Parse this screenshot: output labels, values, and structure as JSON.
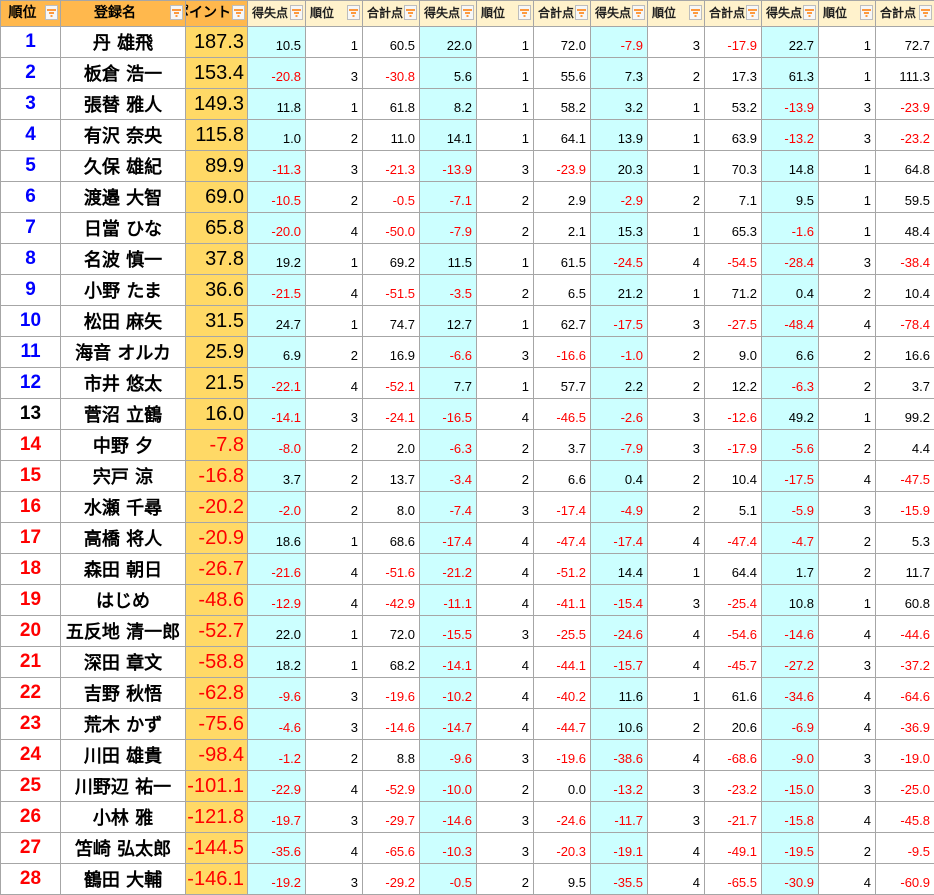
{
  "headers": [
    "順位",
    "登録名",
    "ポイント",
    "得失点",
    "順位",
    "合計点",
    "得失点",
    "順位",
    "合計点",
    "得失点",
    "順位",
    "合計点",
    "得失点",
    "順位",
    "合計点"
  ],
  "rows": [
    {
      "rank": "1",
      "name": "丹 雄飛",
      "pts": "187.3",
      "cells": [
        "10.5",
        "1",
        "60.5",
        "22.0",
        "1",
        "72.0",
        "-7.9",
        "3",
        "-17.9",
        "22.7",
        "1",
        "72.7"
      ]
    },
    {
      "rank": "2",
      "name": "板倉 浩一",
      "pts": "153.4",
      "cells": [
        "-20.8",
        "3",
        "-30.8",
        "5.6",
        "1",
        "55.6",
        "7.3",
        "2",
        "17.3",
        "61.3",
        "1",
        "111.3"
      ]
    },
    {
      "rank": "3",
      "name": "張替 雅人",
      "pts": "149.3",
      "cells": [
        "11.8",
        "1",
        "61.8",
        "8.2",
        "1",
        "58.2",
        "3.2",
        "1",
        "53.2",
        "-13.9",
        "3",
        "-23.9"
      ]
    },
    {
      "rank": "4",
      "name": "有沢 奈央",
      "pts": "115.8",
      "cells": [
        "1.0",
        "2",
        "11.0",
        "14.1",
        "1",
        "64.1",
        "13.9",
        "1",
        "63.9",
        "-13.2",
        "3",
        "-23.2"
      ]
    },
    {
      "rank": "5",
      "name": "久保 雄紀",
      "pts": "89.9",
      "cells": [
        "-11.3",
        "3",
        "-21.3",
        "-13.9",
        "3",
        "-23.9",
        "20.3",
        "1",
        "70.3",
        "14.8",
        "1",
        "64.8"
      ]
    },
    {
      "rank": "6",
      "name": "渡邉 大智",
      "pts": "69.0",
      "cells": [
        "-10.5",
        "2",
        "-0.5",
        "-7.1",
        "2",
        "2.9",
        "-2.9",
        "2",
        "7.1",
        "9.5",
        "1",
        "59.5"
      ]
    },
    {
      "rank": "7",
      "name": "日當 ひな",
      "pts": "65.8",
      "cells": [
        "-20.0",
        "4",
        "-50.0",
        "-7.9",
        "2",
        "2.1",
        "15.3",
        "1",
        "65.3",
        "-1.6",
        "1",
        "48.4"
      ]
    },
    {
      "rank": "8",
      "name": "名波 慎一",
      "pts": "37.8",
      "cells": [
        "19.2",
        "1",
        "69.2",
        "11.5",
        "1",
        "61.5",
        "-24.5",
        "4",
        "-54.5",
        "-28.4",
        "3",
        "-38.4"
      ]
    },
    {
      "rank": "9",
      "name": "小野 たま",
      "pts": "36.6",
      "cells": [
        "-21.5",
        "4",
        "-51.5",
        "-3.5",
        "2",
        "6.5",
        "21.2",
        "1",
        "71.2",
        "0.4",
        "2",
        "10.4"
      ]
    },
    {
      "rank": "10",
      "name": "松田 麻矢",
      "pts": "31.5",
      "cells": [
        "24.7",
        "1",
        "74.7",
        "12.7",
        "1",
        "62.7",
        "-17.5",
        "3",
        "-27.5",
        "-48.4",
        "4",
        "-78.4"
      ]
    },
    {
      "rank": "11",
      "name": "海音 オルカ",
      "pts": "25.9",
      "cells": [
        "6.9",
        "2",
        "16.9",
        "-6.6",
        "3",
        "-16.6",
        "-1.0",
        "2",
        "9.0",
        "6.6",
        "2",
        "16.6"
      ]
    },
    {
      "rank": "12",
      "name": "市井 悠太",
      "pts": "21.5",
      "cells": [
        "-22.1",
        "4",
        "-52.1",
        "7.7",
        "1",
        "57.7",
        "2.2",
        "2",
        "12.2",
        "-6.3",
        "2",
        "3.7"
      ]
    },
    {
      "rank": "13",
      "name": "菅沼 立鶴",
      "pts": "16.0",
      "cells": [
        "-14.1",
        "3",
        "-24.1",
        "-16.5",
        "4",
        "-46.5",
        "-2.6",
        "3",
        "-12.6",
        "49.2",
        "1",
        "99.2"
      ]
    },
    {
      "rank": "14",
      "name": "中野 夕",
      "pts": "-7.8",
      "cells": [
        "-8.0",
        "2",
        "2.0",
        "-6.3",
        "2",
        "3.7",
        "-7.9",
        "3",
        "-17.9",
        "-5.6",
        "2",
        "4.4"
      ]
    },
    {
      "rank": "15",
      "name": "宍戸 涼",
      "pts": "-16.8",
      "cells": [
        "3.7",
        "2",
        "13.7",
        "-3.4",
        "2",
        "6.6",
        "0.4",
        "2",
        "10.4",
        "-17.5",
        "4",
        "-47.5"
      ]
    },
    {
      "rank": "16",
      "name": "水瀬 千尋",
      "pts": "-20.2",
      "cells": [
        "-2.0",
        "2",
        "8.0",
        "-7.4",
        "3",
        "-17.4",
        "-4.9",
        "2",
        "5.1",
        "-5.9",
        "3",
        "-15.9"
      ]
    },
    {
      "rank": "17",
      "name": "高橋 将人",
      "pts": "-20.9",
      "cells": [
        "18.6",
        "1",
        "68.6",
        "-17.4",
        "4",
        "-47.4",
        "-17.4",
        "4",
        "-47.4",
        "-4.7",
        "2",
        "5.3"
      ]
    },
    {
      "rank": "18",
      "name": "森田 朝日",
      "pts": "-26.7",
      "cells": [
        "-21.6",
        "4",
        "-51.6",
        "-21.2",
        "4",
        "-51.2",
        "14.4",
        "1",
        "64.4",
        "1.7",
        "2",
        "11.7"
      ]
    },
    {
      "rank": "19",
      "name": "はじめ",
      "pts": "-48.6",
      "cells": [
        "-12.9",
        "4",
        "-42.9",
        "-11.1",
        "4",
        "-41.1",
        "-15.4",
        "3",
        "-25.4",
        "10.8",
        "1",
        "60.8"
      ]
    },
    {
      "rank": "20",
      "name": "五反地 清一郎",
      "pts": "-52.7",
      "cells": [
        "22.0",
        "1",
        "72.0",
        "-15.5",
        "3",
        "-25.5",
        "-24.6",
        "4",
        "-54.6",
        "-14.6",
        "4",
        "-44.6"
      ]
    },
    {
      "rank": "21",
      "name": "深田 章文",
      "pts": "-58.8",
      "cells": [
        "18.2",
        "1",
        "68.2",
        "-14.1",
        "4",
        "-44.1",
        "-15.7",
        "4",
        "-45.7",
        "-27.2",
        "3",
        "-37.2"
      ]
    },
    {
      "rank": "22",
      "name": "吉野 秋悟",
      "pts": "-62.8",
      "cells": [
        "-9.6",
        "3",
        "-19.6",
        "-10.2",
        "4",
        "-40.2",
        "11.6",
        "1",
        "61.6",
        "-34.6",
        "4",
        "-64.6"
      ]
    },
    {
      "rank": "23",
      "name": "荒木 かず",
      "pts": "-75.6",
      "cells": [
        "-4.6",
        "3",
        "-14.6",
        "-14.7",
        "4",
        "-44.7",
        "10.6",
        "2",
        "20.6",
        "-6.9",
        "4",
        "-36.9"
      ]
    },
    {
      "rank": "24",
      "name": "川田 雄貴",
      "pts": "-98.4",
      "cells": [
        "-1.2",
        "2",
        "8.8",
        "-9.6",
        "3",
        "-19.6",
        "-38.6",
        "4",
        "-68.6",
        "-9.0",
        "3",
        "-19.0"
      ]
    },
    {
      "rank": "25",
      "name": "川野辺 祐一",
      "pts": "-101.1",
      "cells": [
        "-22.9",
        "4",
        "-52.9",
        "-10.0",
        "2",
        "0.0",
        "-13.2",
        "3",
        "-23.2",
        "-15.0",
        "3",
        "-25.0"
      ]
    },
    {
      "rank": "26",
      "name": "小林 雅",
      "pts": "-121.8",
      "cells": [
        "-19.7",
        "3",
        "-29.7",
        "-14.6",
        "3",
        "-24.6",
        "-11.7",
        "3",
        "-21.7",
        "-15.8",
        "4",
        "-45.8"
      ]
    },
    {
      "rank": "27",
      "name": "笘崎 弘太郎",
      "pts": "-144.5",
      "cells": [
        "-35.6",
        "4",
        "-65.6",
        "-10.3",
        "3",
        "-20.3",
        "-19.1",
        "4",
        "-49.1",
        "-19.5",
        "2",
        "-9.5"
      ]
    },
    {
      "rank": "28",
      "name": "鶴田 大輔",
      "pts": "-146.1",
      "cells": [
        "-19.2",
        "3",
        "-29.2",
        "-0.5",
        "2",
        "9.5",
        "-35.5",
        "4",
        "-65.5",
        "-30.9",
        "4",
        "-60.9"
      ]
    }
  ],
  "colors": {
    "rank_top": "#0000ff",
    "rank_other": "#000000",
    "rank_negative": "#ff0000",
    "negative": "#ff0000",
    "header_orange": "#ffb84d",
    "header_cream": "#fff2cc",
    "points_bg": "#ffd966",
    "cyan_bg": "#ccffff"
  }
}
